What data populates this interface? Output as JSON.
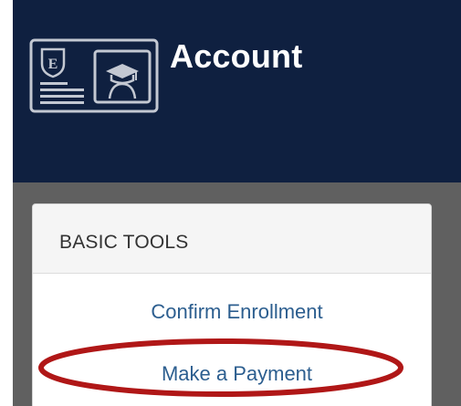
{
  "header": {
    "title": "Account",
    "logo_icon": "student-id-card-icon",
    "background_color": "#0f2040"
  },
  "basic_tools": {
    "heading": "BASIC TOOLS",
    "items": [
      {
        "label": "Confirm Enrollment"
      },
      {
        "label": "Make a Payment"
      }
    ]
  },
  "annotation": {
    "highlight_color": "#b01717",
    "highlighted_item": "Make a Payment"
  }
}
